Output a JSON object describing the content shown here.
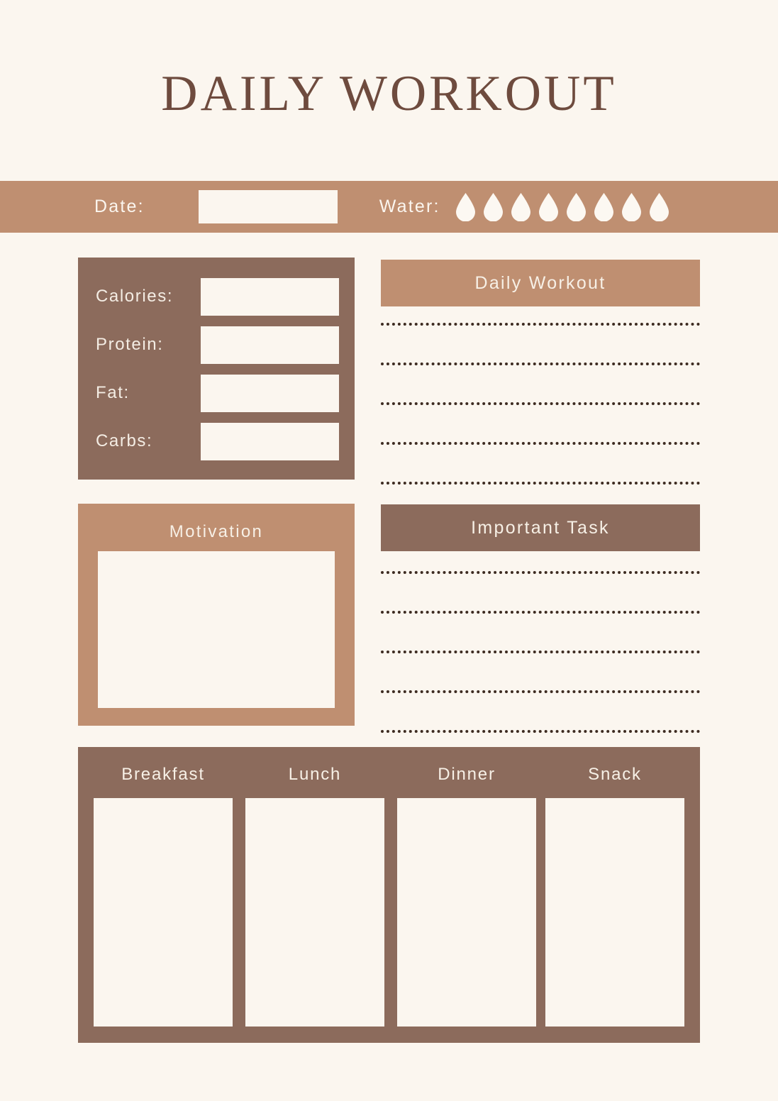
{
  "page": {
    "title": "DAILY WORKOUT",
    "background_color": "#FBF6EF",
    "title_color": "#6E4B3E",
    "accent_tan": "#BF8F71",
    "accent_brown": "#8C6B5C",
    "field_fill": "#FBF6EF",
    "dot_color": "#3D2B21"
  },
  "datebar": {
    "date_label": "Date:",
    "date_value": "",
    "date_placeholder": "",
    "water_label": "Water:",
    "water_icon": "water-droplet-icon",
    "water_count": 8,
    "water_filled": 0
  },
  "nutrition": {
    "rows": [
      {
        "label": "Calories:",
        "value": ""
      },
      {
        "label": "Protein:",
        "value": ""
      },
      {
        "label": "Fat:",
        "value": ""
      },
      {
        "label": "Carbs:",
        "value": ""
      }
    ]
  },
  "motivation": {
    "title": "Motivation",
    "value": ""
  },
  "daily_workout": {
    "title": "Daily Workout",
    "line_count": 5,
    "lines": [
      "",
      "",
      "",
      "",
      ""
    ]
  },
  "important_task": {
    "title": "Important Task",
    "line_count": 5,
    "lines": [
      "",
      "",
      "",
      "",
      ""
    ]
  },
  "meals": {
    "columns": [
      {
        "title": "Breakfast",
        "value": ""
      },
      {
        "title": "Lunch",
        "value": ""
      },
      {
        "title": "Dinner",
        "value": ""
      },
      {
        "title": "Snack",
        "value": ""
      }
    ]
  }
}
